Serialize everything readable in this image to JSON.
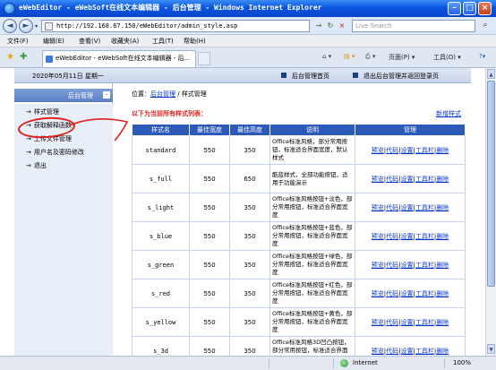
{
  "window": {
    "title": "eWebEditor - eWebSoft在线文本编辑器 - 后台管理 - Windows Internet Explorer",
    "min": "–",
    "max": "□",
    "close": "×"
  },
  "address": {
    "url": "http://192.168.67.150/eWebEditor/admin_style.asp",
    "search_placeholder": "Live Search",
    "back": "◄",
    "forward": "►",
    "dropdown": "▾",
    "go": "→",
    "refresh": "↻",
    "stop": "×",
    "search_go": "⌕"
  },
  "menu": [
    "文件(F)",
    "编辑(E)",
    "查看(V)",
    "收藏夹(A)",
    "工具(T)",
    "帮助(H)"
  ],
  "tabs": {
    "active": "eWebEditor - eWebSoft在线文本编辑器 - 后...",
    "tools": [
      "页面(P) ▾",
      "工具(O) ▾"
    ]
  },
  "header": {
    "date": "2020年05月11日 星期一",
    "link_home": "后台管理首页",
    "link_logout": "退出后台管理并返回登录页"
  },
  "sidebar": {
    "title": "后台管理",
    "toggle": "-",
    "items": [
      {
        "label": "样式管理"
      },
      {
        "label": "获取解释函数"
      },
      {
        "label": "上传文件管理"
      },
      {
        "label": "用户名及密码修改"
      },
      {
        "label": "退出"
      }
    ],
    "arrow": "→"
  },
  "breadcrumb": {
    "prefix": "位置：",
    "home": "后台管理",
    "sep": " / ",
    "current": "样式管理"
  },
  "main": {
    "heading": "以下为当前所有样式列表：",
    "new_style": "新增样式"
  },
  "table": {
    "headers": [
      "样式名",
      "最佳宽度",
      "最佳高度",
      "说明",
      "管理"
    ],
    "ops": [
      "预览",
      "代码",
      "设置",
      "工具栏",
      "删除"
    ],
    "rows": [
      {
        "name": "standard",
        "w": "550",
        "h": "350",
        "desc": "Office标准风格，部分常用按钮，标准适合界面宽度，默认样式"
      },
      {
        "name": "s_full",
        "w": "550",
        "h": "650",
        "desc": "酷蓝样式，全部功能按钮，适用于功能演示"
      },
      {
        "name": "s_light",
        "w": "550",
        "h": "350",
        "desc": "Office标准风格按钮+淡色，部分常用按钮，标准适合界面宽度"
      },
      {
        "name": "s_blue",
        "w": "550",
        "h": "350",
        "desc": "Office标准风格按钮+蓝色，部分常用按钮，标准适合界面宽度"
      },
      {
        "name": "s_green",
        "w": "550",
        "h": "350",
        "desc": "Office标准风格按钮+绿色，部分常用按钮，标准适合界面宽度"
      },
      {
        "name": "s_red",
        "w": "550",
        "h": "350",
        "desc": "Office标准风格按钮+红色，部分常用按钮，标准适合界面宽度"
      },
      {
        "name": "s_yellow",
        "w": "550",
        "h": "350",
        "desc": "Office标准风格按钮+黄色，部分常用按钮，标准适合界面宽度"
      },
      {
        "name": "s_3d",
        "w": "550",
        "h": "350",
        "desc": "Office标准风格3D凹凸按钮，部分常用按钮，标准适合界面宽度"
      }
    ]
  },
  "status": {
    "zone": "Internet",
    "zoom": "100%"
  }
}
